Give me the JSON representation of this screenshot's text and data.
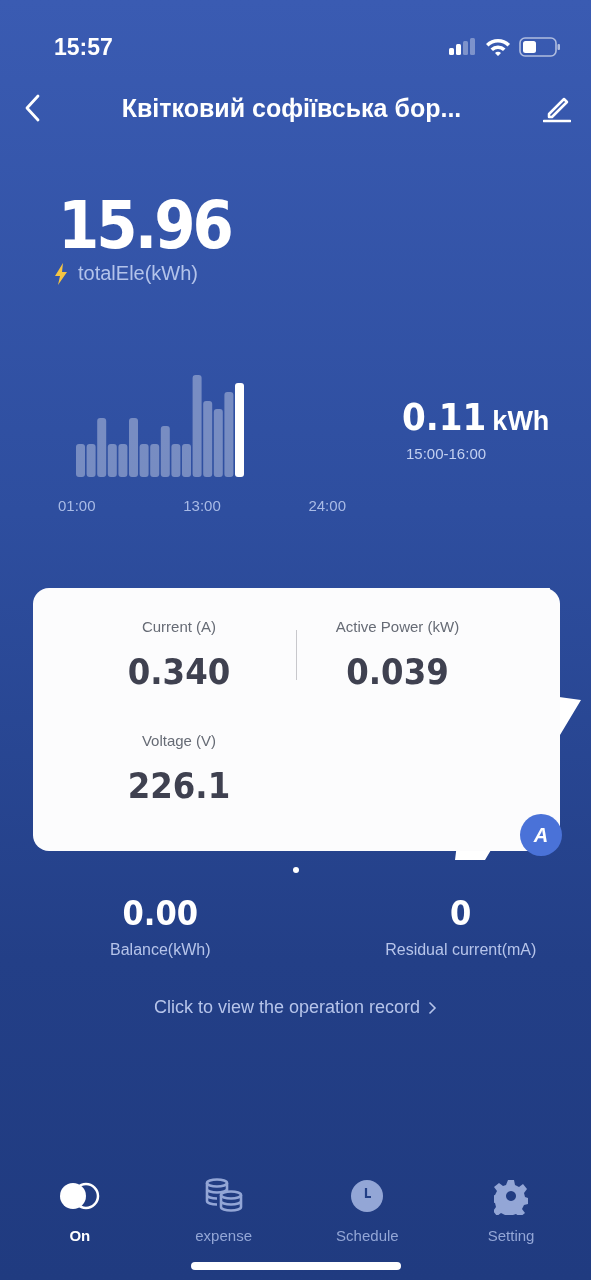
{
  "status_bar": {
    "time": "15:57"
  },
  "header": {
    "title": "Квітковий софіївська бор..."
  },
  "total": {
    "value": "15.96",
    "label": "totalEle(kWh)"
  },
  "usage_chart": {
    "axis_labels": [
      "01:00",
      "13:00",
      "24:00"
    ],
    "reading": "0.11",
    "unit": "kWh",
    "period": "15:00-16:00"
  },
  "metrics": [
    {
      "label": "Current (A)",
      "value": "0.340"
    },
    {
      "label": "Active Power (kW)",
      "value": "0.039"
    },
    {
      "label": "Voltage (V)",
      "value": "226.1"
    }
  ],
  "card_badge": "A",
  "pager": [
    {
      "selected": true
    }
  ],
  "summary": [
    {
      "value": "0.00",
      "label": "Balance(kWh)"
    },
    {
      "value": "0",
      "label": "Residual current(mA)"
    }
  ],
  "record_link": "Click to view the operation record",
  "tabs": [
    {
      "kind": "power",
      "label": "On",
      "selected": true
    },
    {
      "kind": "expense",
      "label": "expense",
      "selected": false
    },
    {
      "kind": "schedule",
      "label": "Schedule",
      "selected": false
    },
    {
      "kind": "setting",
      "label": "Setting",
      "selected": false
    }
  ]
}
